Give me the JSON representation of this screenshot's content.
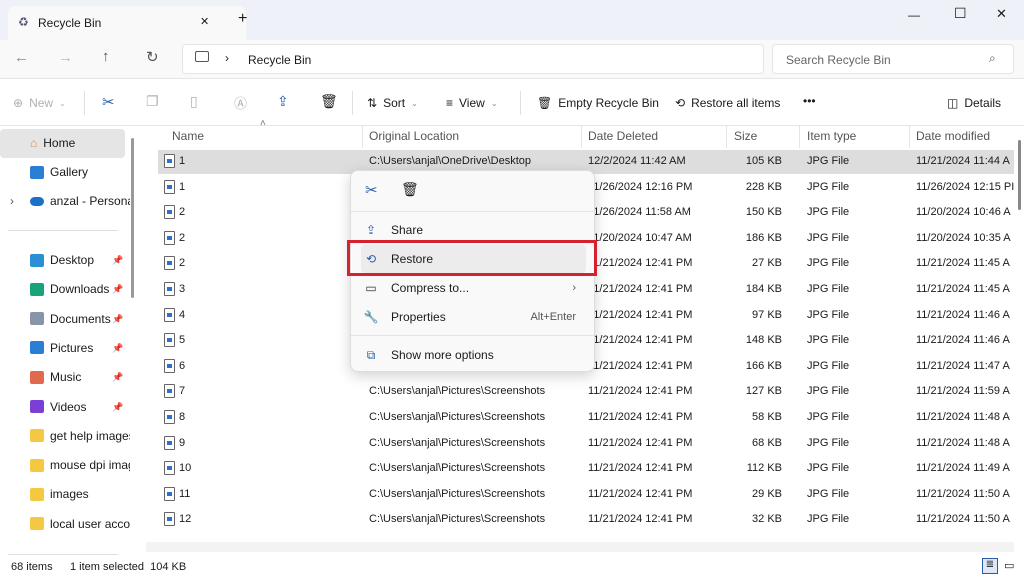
{
  "window": {
    "tab_title": "Recycle Bin",
    "new_tab": "+",
    "minimize": "—",
    "maximize": "☐",
    "close": "✕",
    "tab_close": "✕"
  },
  "address": {
    "location": "Recycle Bin",
    "search_placeholder": "Search Recycle Bin"
  },
  "toolbar": {
    "new": "New",
    "sort": "Sort",
    "view": "View",
    "empty": "Empty Recycle Bin",
    "restore_all": "Restore all items",
    "more": "•••",
    "details": "Details"
  },
  "sidebar": {
    "top": [
      {
        "label": "Home",
        "icon": "home-icon"
      },
      {
        "label": "Gallery",
        "icon": "gallery-icon"
      },
      {
        "label": "anzal - Personal",
        "icon": "onedrive-icon"
      }
    ],
    "pinned": [
      {
        "label": "Desktop",
        "color": "#2b8fd8"
      },
      {
        "label": "Downloads",
        "color": "#1aa37a"
      },
      {
        "label": "Documents",
        "color": "#8795a8"
      },
      {
        "label": "Pictures",
        "color": "#2a7fd4"
      },
      {
        "label": "Music",
        "color": "#e06a4d"
      },
      {
        "label": "Videos",
        "color": "#7b3fd6"
      },
      {
        "label": "get help images",
        "color": "#f5c842"
      },
      {
        "label": "mouse dpi imag",
        "color": "#f5c842"
      },
      {
        "label": "images",
        "color": "#f5c842"
      },
      {
        "label": "local user accou",
        "color": "#f5c842"
      }
    ]
  },
  "columns": {
    "name": "Name",
    "location": "Original Location",
    "deleted": "Date Deleted",
    "size": "Size",
    "type": "Item type",
    "modified": "Date modified"
  },
  "rows": [
    {
      "name": "1",
      "location": "C:\\Users\\anjal\\OneDrive\\Desktop",
      "deleted": "12/2/2024 11:42 AM",
      "size": "105 KB",
      "type": "JPG File",
      "modified": "11/21/2024 11:44 A"
    },
    {
      "name": "1",
      "location": "",
      "deleted": "11/26/2024 12:16 PM",
      "size": "228 KB",
      "type": "JPG File",
      "modified": "11/26/2024 12:15 PI"
    },
    {
      "name": "2",
      "location": "",
      "deleted": "11/26/2024 11:58 AM",
      "size": "150 KB",
      "type": "JPG File",
      "modified": "11/20/2024 10:46 A"
    },
    {
      "name": "2",
      "location": "",
      "deleted": "11/20/2024 10:47 AM",
      "size": "186 KB",
      "type": "JPG File",
      "modified": "11/20/2024 10:35 A"
    },
    {
      "name": "2",
      "location": "",
      "deleted": "11/21/2024 12:41 PM",
      "size": "27 KB",
      "type": "JPG File",
      "modified": "11/21/2024 11:45 A"
    },
    {
      "name": "3",
      "location": "",
      "deleted": "11/21/2024 12:41 PM",
      "size": "184 KB",
      "type": "JPG File",
      "modified": "11/21/2024 11:45 A"
    },
    {
      "name": "4",
      "location": "",
      "deleted": "11/21/2024 12:41 PM",
      "size": "97 KB",
      "type": "JPG File",
      "modified": "11/21/2024 11:46 A"
    },
    {
      "name": "5",
      "location": "",
      "deleted": "11/21/2024 12:41 PM",
      "size": "148 KB",
      "type": "JPG File",
      "modified": "11/21/2024 11:46 A"
    },
    {
      "name": "6",
      "location": "",
      "deleted": "11/21/2024 12:41 PM",
      "size": "166 KB",
      "type": "JPG File",
      "modified": "11/21/2024 11:47 A"
    },
    {
      "name": "7",
      "location": "C:\\Users\\anjal\\Pictures\\Screenshots",
      "deleted": "11/21/2024 12:41 PM",
      "size": "127 KB",
      "type": "JPG File",
      "modified": "11/21/2024 11:59 A"
    },
    {
      "name": "8",
      "location": "C:\\Users\\anjal\\Pictures\\Screenshots",
      "deleted": "11/21/2024 12:41 PM",
      "size": "58 KB",
      "type": "JPG File",
      "modified": "11/21/2024 11:48 A"
    },
    {
      "name": "9",
      "location": "C:\\Users\\anjal\\Pictures\\Screenshots",
      "deleted": "11/21/2024 12:41 PM",
      "size": "68 KB",
      "type": "JPG File",
      "modified": "11/21/2024 11:48 A"
    },
    {
      "name": "10",
      "location": "C:\\Users\\anjal\\Pictures\\Screenshots",
      "deleted": "11/21/2024 12:41 PM",
      "size": "112 KB",
      "type": "JPG File",
      "modified": "11/21/2024 11:49 A"
    },
    {
      "name": "11",
      "location": "C:\\Users\\anjal\\Pictures\\Screenshots",
      "deleted": "11/21/2024 12:41 PM",
      "size": "29 KB",
      "type": "JPG File",
      "modified": "11/21/2024 11:50 A"
    },
    {
      "name": "12",
      "location": "C:\\Users\\anjal\\Pictures\\Screenshots",
      "deleted": "11/21/2024 12:41 PM",
      "size": "32 KB",
      "type": "JPG File",
      "modified": "11/21/2024 11:50 A"
    }
  ],
  "context_menu": {
    "share": "Share",
    "restore": "Restore",
    "compress": "Compress to...",
    "properties": "Properties",
    "properties_shortcut": "Alt+Enter",
    "more_options": "Show more options",
    "highlight_color": "#d4232f"
  },
  "status": {
    "count": "68 items",
    "selected": "1 item selected  104 KB"
  }
}
